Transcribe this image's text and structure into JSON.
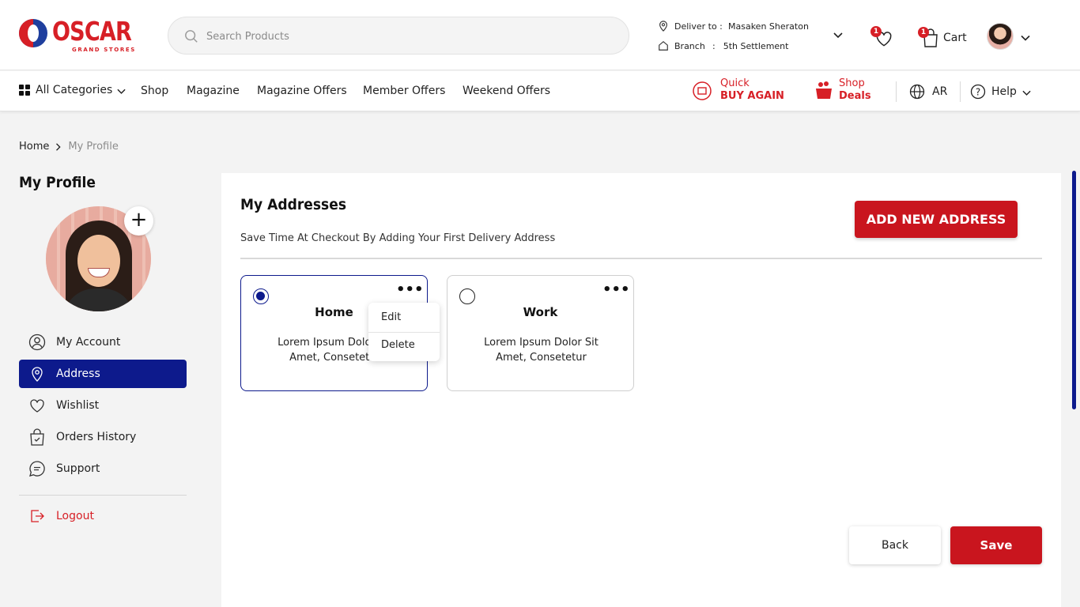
{
  "brand": {
    "name": "OSCAR",
    "tagline": "GRAND STORES",
    "colors": {
      "red": "#d71f26",
      "navy": "#0d1a8c"
    }
  },
  "search": {
    "placeholder": "Search Products"
  },
  "delivery": {
    "deliver_label": "Deliver to :",
    "deliver_value": "Masaken Sheraton",
    "branch_label": "Branch",
    "branch_sep": ":",
    "branch_value": "5th Settlement"
  },
  "header": {
    "wishlist_count": "1",
    "cart_count": "1",
    "cart_label": "Cart"
  },
  "nav": {
    "all_categories": "All Categories",
    "items": [
      "Shop",
      "Magazine",
      "Magazine Offers",
      "Member Offers",
      "Weekend Offers"
    ],
    "quick_line1": "Quick",
    "quick_line2": "BUY AGAIN",
    "shop_line1": "Shop",
    "shop_line2": "Deals",
    "language": "AR",
    "help": "Help"
  },
  "breadcrumb": {
    "home": "Home",
    "current": "My Profile"
  },
  "sidebar": {
    "title": "My Profile",
    "items": [
      {
        "label": "My Account",
        "icon": "user-icon"
      },
      {
        "label": "Address",
        "icon": "location-pin-icon",
        "active": true
      },
      {
        "label": "Wishlist",
        "icon": "heart-icon"
      },
      {
        "label": "Orders History",
        "icon": "bag-icon"
      },
      {
        "label": "Support",
        "icon": "chat-icon"
      }
    ],
    "logout": "Logout"
  },
  "addresses": {
    "title": "My Addresses",
    "subtitle": "Save Time At Checkout By Adding Your First Delivery Address",
    "add_button": "ADD NEW ADDRESS",
    "cards": [
      {
        "name": "Home",
        "line1": "Lorem Ipsum Dolor Sit",
        "line2": "Amet, Consetetur",
        "selected": true
      },
      {
        "name": "Work",
        "line1": "Lorem Ipsum Dolor Sit",
        "line2": "Amet, Consetetur",
        "selected": false
      }
    ],
    "menu": {
      "edit": "Edit",
      "delete": "Delete"
    },
    "more_glyph": "•••"
  },
  "actions": {
    "back": "Back",
    "save": "Save"
  }
}
